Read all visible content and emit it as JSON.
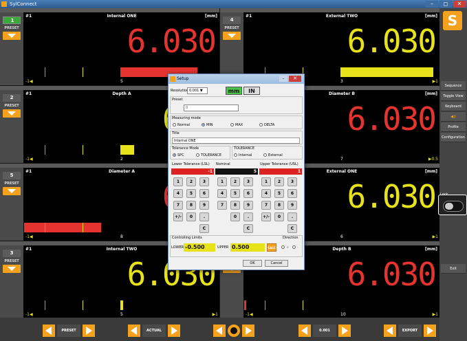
{
  "window": {
    "title": "SylConnect",
    "min": "–",
    "max": "◻",
    "close": "✕"
  },
  "panels": [
    {
      "num": "1",
      "preset": "PRESET",
      "hash": "#1",
      "title": "Internal ONE",
      "unit": "[mm]",
      "value": "6.030",
      "color": "red",
      "scale_left": "-1◀",
      "scale_mid": "5",
      "scale_right": ""
    },
    {
      "num": "4",
      "preset": "PRESET",
      "hash": "#1",
      "title": "External TWO",
      "unit": "[mm]",
      "value": "6.030",
      "color": "yellow",
      "scale_left": "",
      "scale_mid": "3",
      "scale_right": "▶1"
    },
    {
      "num": "2",
      "preset": "PRESET",
      "hash": "#1",
      "title": "Depth A",
      "unit": "",
      "value": "6.0",
      "color": "yellow",
      "scale_left": "-1◀",
      "scale_mid": "2",
      "scale_right": ""
    },
    {
      "num": "",
      "preset": "",
      "hash": "",
      "title": "Diameter B",
      "unit": "[mm]",
      "value": "6.030",
      "color": "red",
      "scale_left": "",
      "scale_mid": "7",
      "scale_right": "▶0.5"
    },
    {
      "num": "5",
      "preset": "PRESET",
      "hash": "#1",
      "title": "Diameter A",
      "unit": "",
      "value": "6.0",
      "color": "red",
      "scale_left": "-1◀",
      "scale_mid": "8",
      "scale_right": ""
    },
    {
      "num": "",
      "preset": "",
      "hash": "",
      "title": "External ONE",
      "unit": "[mm]",
      "value": "6.030",
      "color": "yellow",
      "scale_left": "",
      "scale_mid": "6",
      "scale_right": "▶1"
    },
    {
      "num": "3",
      "preset": "PRESET",
      "hash": "#1",
      "title": "Internal TWO",
      "unit": "[mm]",
      "value": "6.030",
      "color": "yellow",
      "scale_left": "-1◀",
      "scale_mid": "5",
      "scale_right": "▶1"
    },
    {
      "num": "6",
      "preset": "PRESET",
      "hash": "#1",
      "title": "Depth B",
      "unit": "[mm]",
      "value": "6.030",
      "color": "red",
      "scale_left": "-1◀",
      "scale_mid": "10",
      "scale_right": "▶1"
    }
  ],
  "rightbar": {
    "logo": "S",
    "sequence": "Sequence",
    "toggle": "Toggle View",
    "keyboard": "Keyboard",
    "sound": "◀))",
    "profile": "Profile",
    "configuration": "Configuration",
    "lock": "Lock",
    "exit": "Exit"
  },
  "bottom": {
    "preset": "PRESET",
    "actual": "ACTUAL",
    "resolution": "0.001",
    "export": "EXPORT"
  },
  "dialog": {
    "title": "Setup",
    "resolution_label": "Resolution",
    "resolution_value": "0.001 ▼",
    "unit_mm": "mm",
    "unit_in": "IN",
    "preset_label": "Preset",
    "preset_value": "0",
    "mode_label": "Measuring mode",
    "mode_normal": "Normal",
    "mode_min": "MIN",
    "mode_max": "MAX",
    "mode_delta": "DELTA",
    "title_label": "Title",
    "title_value": "Internal ONE",
    "tolmode_label": "Tolerance Mode",
    "tol_spc": "SPC",
    "tol_tolerance": "TOLERANCE",
    "tolerance_label": "TOLERANCE",
    "tol_internal": "Internal",
    "tol_external": "External",
    "lower_label": "Lower Tolerance (LSL)",
    "nominal_label": "Nominal",
    "upper_label": "Upper Tolerance (USL)",
    "lower_value": "-1",
    "nominal_value": "5",
    "upper_value": "1",
    "limits_label": "Controlling Limits",
    "direction_label": "Direction",
    "lower_lbl": "LOWER",
    "lower_limit": "-0.500",
    "upper_lbl": "UPPER",
    "upper_limit": "0.500",
    "calc": "CALC",
    "dir_plus": "+",
    "dir_minus": "-",
    "ok": "OK",
    "cancel": "Cancel"
  },
  "keypad": [
    "1",
    "2",
    "3",
    "4",
    "5",
    "6",
    "7",
    "8",
    "9",
    "+/-",
    "0",
    "."
  ],
  "keypad_c": "C"
}
